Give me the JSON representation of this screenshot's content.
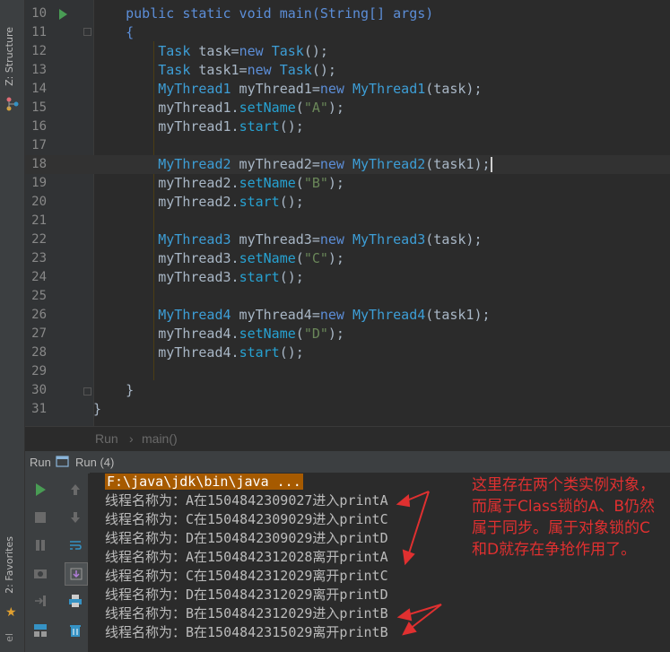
{
  "side_panel": {
    "structure_label": "Z: Structure",
    "favorites_label": "2: Favorites",
    "clipped_label": "el"
  },
  "editor": {
    "lines": [
      {
        "num": "10",
        "tokens": [
          {
            "t": "    ",
            "c": "pl"
          },
          {
            "t": "public static void ",
            "c": "kw"
          },
          {
            "t": "main",
            "c": "kw"
          },
          {
            "t": "(String[] args)",
            "c": "kw"
          }
        ]
      },
      {
        "num": "11",
        "tokens": [
          {
            "t": "    {",
            "c": "kw"
          }
        ]
      },
      {
        "num": "12",
        "tokens": [
          {
            "t": "        ",
            "c": "pl"
          },
          {
            "t": "Task",
            "c": "ty"
          },
          {
            "t": " task=",
            "c": "pl"
          },
          {
            "t": "new ",
            "c": "kw"
          },
          {
            "t": "Task",
            "c": "ty"
          },
          {
            "t": "();",
            "c": "pl"
          }
        ]
      },
      {
        "num": "13",
        "tokens": [
          {
            "t": "        ",
            "c": "pl"
          },
          {
            "t": "Task",
            "c": "ty"
          },
          {
            "t": " task1=",
            "c": "pl"
          },
          {
            "t": "new ",
            "c": "kw"
          },
          {
            "t": "Task",
            "c": "ty"
          },
          {
            "t": "();",
            "c": "pl"
          }
        ]
      },
      {
        "num": "14",
        "tokens": [
          {
            "t": "        ",
            "c": "pl"
          },
          {
            "t": "MyThread1",
            "c": "ty"
          },
          {
            "t": " myThread1=",
            "c": "pl"
          },
          {
            "t": "new ",
            "c": "kw"
          },
          {
            "t": "MyThread1",
            "c": "ty"
          },
          {
            "t": "(task);",
            "c": "pl"
          }
        ]
      },
      {
        "num": "15",
        "tokens": [
          {
            "t": "        myThread1.",
            "c": "pl"
          },
          {
            "t": "setName",
            "c": "me"
          },
          {
            "t": "(",
            "c": "pl"
          },
          {
            "t": "\"A\"",
            "c": "st"
          },
          {
            "t": ");",
            "c": "pl"
          }
        ]
      },
      {
        "num": "16",
        "tokens": [
          {
            "t": "        myThread1.",
            "c": "pl"
          },
          {
            "t": "start",
            "c": "me"
          },
          {
            "t": "();",
            "c": "pl"
          }
        ]
      },
      {
        "num": "17",
        "tokens": []
      },
      {
        "num": "18",
        "current": true,
        "tokens": [
          {
            "t": "        ",
            "c": "pl"
          },
          {
            "t": "MyThread2",
            "c": "ty"
          },
          {
            "t": " myThread2=",
            "c": "pl"
          },
          {
            "t": "new ",
            "c": "kw"
          },
          {
            "t": "MyThread2",
            "c": "ty"
          },
          {
            "t": "(task1);",
            "c": "pl"
          }
        ]
      },
      {
        "num": "19",
        "tokens": [
          {
            "t": "        myThread2.",
            "c": "pl"
          },
          {
            "t": "setName",
            "c": "me"
          },
          {
            "t": "(",
            "c": "pl"
          },
          {
            "t": "\"B\"",
            "c": "st"
          },
          {
            "t": ");",
            "c": "pl"
          }
        ]
      },
      {
        "num": "20",
        "tokens": [
          {
            "t": "        myThread2.",
            "c": "pl"
          },
          {
            "t": "start",
            "c": "me"
          },
          {
            "t": "();",
            "c": "pl"
          }
        ]
      },
      {
        "num": "21",
        "tokens": []
      },
      {
        "num": "22",
        "tokens": [
          {
            "t": "        ",
            "c": "pl"
          },
          {
            "t": "MyThread3",
            "c": "ty"
          },
          {
            "t": " myThread3=",
            "c": "pl"
          },
          {
            "t": "new ",
            "c": "kw"
          },
          {
            "t": "MyThread3",
            "c": "ty"
          },
          {
            "t": "(task);",
            "c": "pl"
          }
        ]
      },
      {
        "num": "23",
        "tokens": [
          {
            "t": "        myThread3.",
            "c": "pl"
          },
          {
            "t": "setName",
            "c": "me"
          },
          {
            "t": "(",
            "c": "pl"
          },
          {
            "t": "\"C\"",
            "c": "st"
          },
          {
            "t": ");",
            "c": "pl"
          }
        ]
      },
      {
        "num": "24",
        "tokens": [
          {
            "t": "        myThread3.",
            "c": "pl"
          },
          {
            "t": "start",
            "c": "me"
          },
          {
            "t": "();",
            "c": "pl"
          }
        ]
      },
      {
        "num": "25",
        "tokens": []
      },
      {
        "num": "26",
        "tokens": [
          {
            "t": "        ",
            "c": "pl"
          },
          {
            "t": "MyThread4",
            "c": "ty"
          },
          {
            "t": " myThread4=",
            "c": "pl"
          },
          {
            "t": "new ",
            "c": "kw"
          },
          {
            "t": "MyThread4",
            "c": "ty"
          },
          {
            "t": "(task1);",
            "c": "pl"
          }
        ]
      },
      {
        "num": "27",
        "tokens": [
          {
            "t": "        myThread4.",
            "c": "pl"
          },
          {
            "t": "setName",
            "c": "me"
          },
          {
            "t": "(",
            "c": "pl"
          },
          {
            "t": "\"D\"",
            "c": "st"
          },
          {
            "t": ");",
            "c": "pl"
          }
        ]
      },
      {
        "num": "28",
        "tokens": [
          {
            "t": "        myThread4.",
            "c": "pl"
          },
          {
            "t": "start",
            "c": "me"
          },
          {
            "t": "();",
            "c": "pl"
          }
        ]
      },
      {
        "num": "29",
        "tokens": []
      },
      {
        "num": "30",
        "tokens": [
          {
            "t": "    }",
            "c": "pl"
          }
        ]
      },
      {
        "num": "31",
        "tokens": [
          {
            "t": "}",
            "c": "pl"
          }
        ]
      }
    ]
  },
  "breadcrumb": {
    "class_name": "Run",
    "separator": "›",
    "method_name": "main()"
  },
  "run_panel": {
    "header_label": "Run",
    "tab_label": "Run (4)",
    "output": [
      "F:\\java\\jdk\\bin\\java ...",
      "线程名称为：A在1504842309027进入printA",
      "线程名称为：C在1504842309029进入printC",
      "线程名称为：D在1504842309029进入printD",
      "线程名称为：A在1504842312028离开printA",
      "线程名称为：C在1504842312029离开printC",
      "线程名称为：D在1504842312029离开printD",
      "线程名称为：B在1504842312029进入printB",
      "线程名称为：B在1504842315029离开printB"
    ]
  },
  "annotation": {
    "text": "这里存在两个类实例对象，而属于Class锁的A、B仍然属于同步。属于对象锁的C和D就存在争抢作用了。",
    "color": "#e03030"
  },
  "colors": {
    "run_green": "#499c54",
    "cmd_highlight": "#a65a00"
  }
}
